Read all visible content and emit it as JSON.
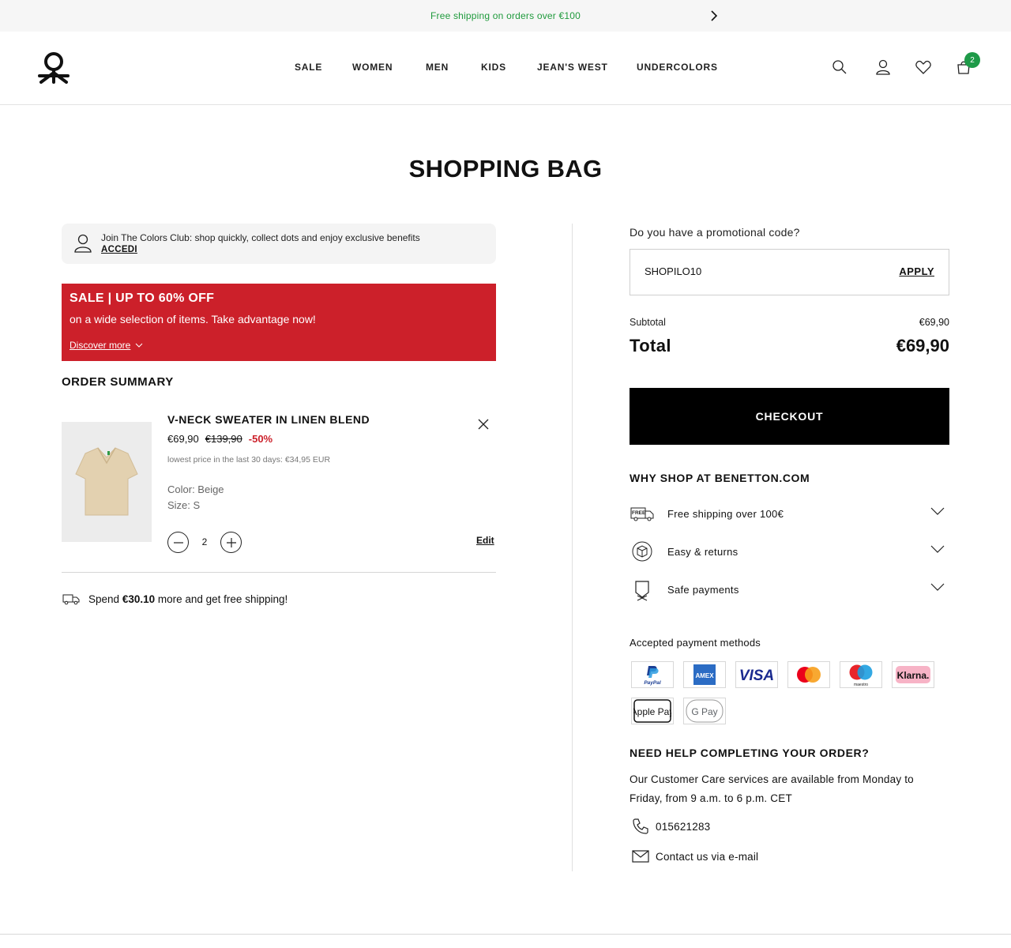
{
  "topbar": {
    "text": "Free shipping on orders over €100"
  },
  "nav": [
    "SALE",
    "WOMEN",
    "MEN",
    "KIDS",
    "JEAN'S WEST",
    "UNDERCOLORS"
  ],
  "header": {
    "cart_count": "2"
  },
  "page_title": "SHOPPING BAG",
  "club": {
    "text": "Join The Colors Club: shop quickly, collect dots and enjoy exclusive benefits",
    "link": "ACCEDI"
  },
  "sale_banner": {
    "title": "SALE | UP TO 60% OFF",
    "subtitle": "on a wide selection of items. Take advantage now!",
    "link": "Discover more",
    "color": "#cc202a"
  },
  "order_summary": {
    "title": "ORDER SUMMARY",
    "item": {
      "name": "V-NECK SWEATER IN LINEN BLEND",
      "price": "€69,90",
      "old_price": "€139,90",
      "discount": "-50%",
      "lowest": "lowest price in the last 30 days: €34,95 EUR",
      "color": "Color: Beige",
      "size": "Size: S",
      "qty": "2",
      "edit": "Edit"
    },
    "shipping_prefix": "Spend",
    "shipping_amount": "€30.10",
    "shipping_suffix": "more and get free shipping!"
  },
  "promo": {
    "question": "Do you have a promotional code?",
    "value": "SHOPILO10",
    "apply": "APPLY"
  },
  "totals": {
    "subtotal_label": "Subtotal",
    "subtotal": "€69,90",
    "total_label": "Total",
    "total": "€69,90"
  },
  "checkout": "CHECKOUT",
  "why": {
    "title": "WHY SHOP AT BENETTON.COM",
    "items": [
      {
        "label": "Free shipping over 100€",
        "icon": "free-shipping-icon"
      },
      {
        "label": "Easy & returns",
        "icon": "returns-box-icon"
      },
      {
        "label": "Safe payments",
        "icon": "shield-icon"
      }
    ]
  },
  "payments": {
    "title": "Accepted payment methods",
    "methods": [
      "PayPal",
      "AMEX",
      "VISA",
      "Mastercard",
      "maestro",
      "Klarna.",
      "Apple Pay",
      "G Pay"
    ]
  },
  "help": {
    "title": "NEED HELP COMPLETING YOUR ORDER?",
    "text": "Our Customer Care services are available from Monday to Friday, from 9 a.m. to 6 p.m. CET",
    "phone": "015621283",
    "email": "Contact us via e-mail"
  },
  "colors": {
    "accent_green": "#1f9a3c",
    "badge_green": "#1e9a48",
    "sale_red": "#cc202a"
  }
}
